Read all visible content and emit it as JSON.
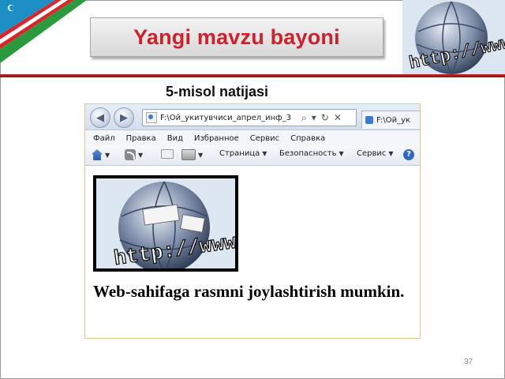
{
  "slide": {
    "title": "Yangi mavzu bayoni",
    "subtitle": "5-misol natijasi",
    "page_number": "37"
  },
  "browser": {
    "address": "F:\\Ой_укитувчиси_апрел_инф_3",
    "tab_title": "F:\\Ой_ук",
    "nav": {
      "back_icon": "back-arrow-icon",
      "forward_icon": "forward-arrow-icon"
    },
    "menu": [
      "Файл",
      "Правка",
      "Вид",
      "Избранное",
      "Сервис",
      "Справка"
    ],
    "command_bar": {
      "page_label": "Страница",
      "safety_label": "Безопасность",
      "service_label": "Сервис"
    }
  },
  "page_content": {
    "image_text": "http://www",
    "text": "Web-sahifaga rasmni joylashtirish mumkin."
  },
  "colors": {
    "title_red": "#d0202a",
    "header_rule": "#b0202a"
  }
}
